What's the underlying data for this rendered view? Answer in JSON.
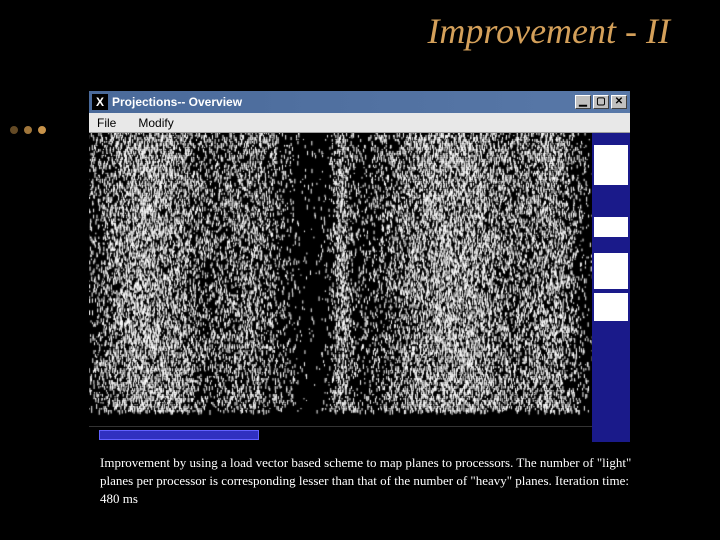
{
  "slide": {
    "title": "Improvement - II",
    "caption": "Improvement by using a load vector based scheme to map planes to processors. The number of \"light\" planes per processor is corresponding lesser than that of the number of \"heavy\" planes. Iteration time: 480 ms"
  },
  "window": {
    "title": "Projections-- Overview",
    "menus": [
      "File",
      "Modify"
    ],
    "controls": {
      "min": "▁",
      "max": "▢",
      "close": "✕"
    }
  }
}
